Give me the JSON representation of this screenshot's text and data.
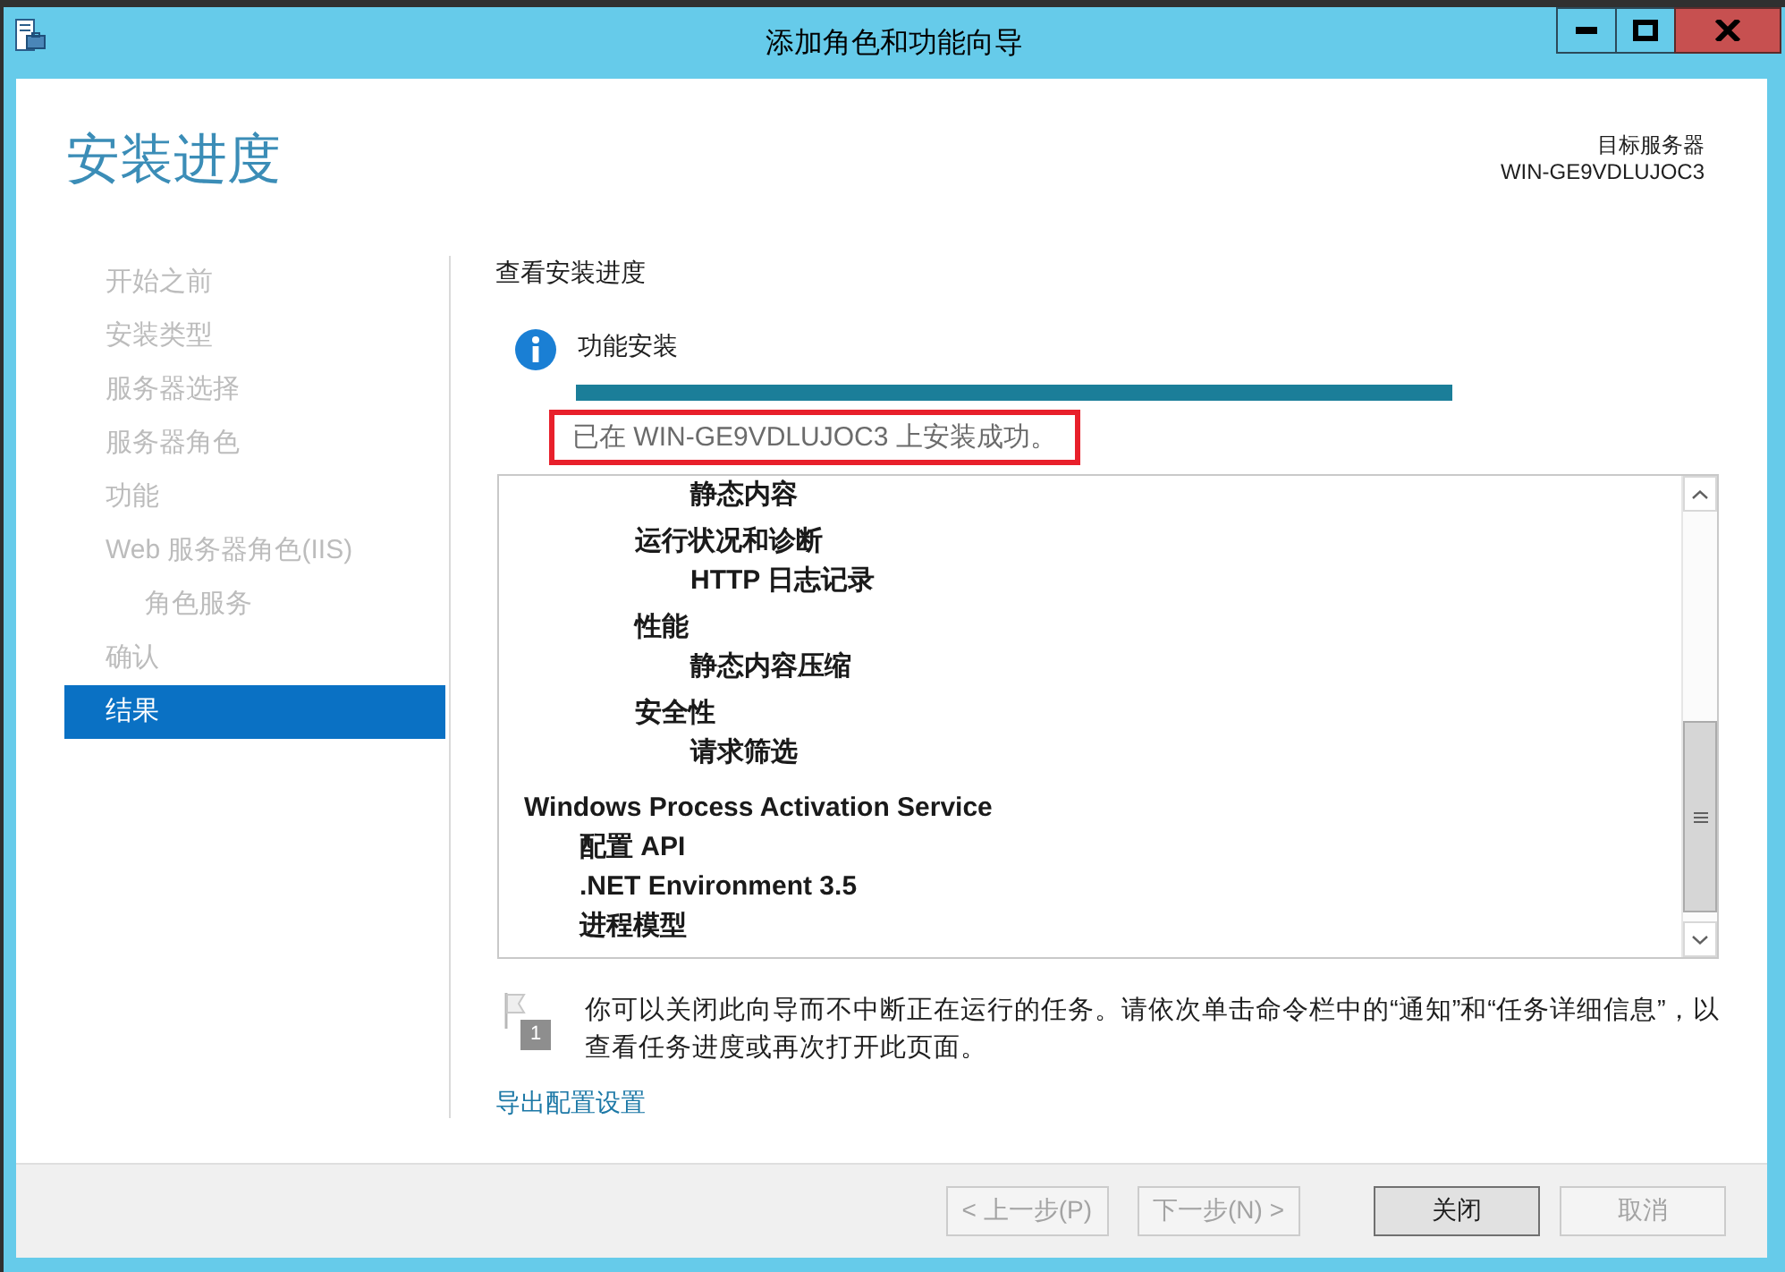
{
  "window": {
    "title": "添加角色和功能向导"
  },
  "header": {
    "title": "安装进度",
    "target_label": "目标服务器",
    "target_server": "WIN-GE9VDLUJOC3"
  },
  "nav": {
    "items": [
      {
        "label": "开始之前",
        "selected": false
      },
      {
        "label": "安装类型",
        "selected": false
      },
      {
        "label": "服务器选择",
        "selected": false
      },
      {
        "label": "服务器角色",
        "selected": false
      },
      {
        "label": "功能",
        "selected": false
      },
      {
        "label": "Web 服务器角色(IIS)",
        "selected": false,
        "children": [
          {
            "label": "角色服务",
            "selected": false
          }
        ]
      },
      {
        "label": "确认",
        "selected": false
      },
      {
        "label": "结果",
        "selected": true
      }
    ]
  },
  "content": {
    "heading": "查看安装进度",
    "install": {
      "title": "功能安装",
      "level": 1,
      "status": "已在 WIN-GE9VDLUJOC3 上安装成功。",
      "highlighted": true
    },
    "results": {
      "items": [
        {
          "children": [
            {
              "children": [
                {
                  "children": [
                    {
                      "label": "静态内容"
                    }
                  ]
                },
                {
                  "label": "运行状况和诊断",
                  "children": [
                    {
                      "label": "HTTP 日志记录"
                    }
                  ]
                },
                {
                  "label": "性能",
                  "children": [
                    {
                      "label": "静态内容压缩"
                    }
                  ]
                },
                {
                  "label": "安全性",
                  "children": [
                    {
                      "label": "请求筛选"
                    }
                  ]
                }
              ]
            }
          ]
        },
        {
          "label": "Windows Process Activation Service",
          "children": [
            {
              "label": "配置 API"
            },
            {
              "label": ".NET Environment 3.5"
            },
            {
              "label": "进程模型"
            }
          ]
        }
      ]
    },
    "note": {
      "badge": "1",
      "text": "你可以关闭此向导而不中断正在运行的任务。请依次单击命令栏中的“通知”和“任务详细信息”，以查看任务进度或再次打开此页面。"
    },
    "link": "导出配置设置"
  },
  "buttons": [
    {
      "label": "< 上一步(P)",
      "disabled": true
    },
    {
      "label": "下一步(N) >",
      "disabled": true
    },
    {
      "label": "关闭",
      "disabled": false
    },
    {
      "label": "取消",
      "disabled": true
    }
  ]
}
